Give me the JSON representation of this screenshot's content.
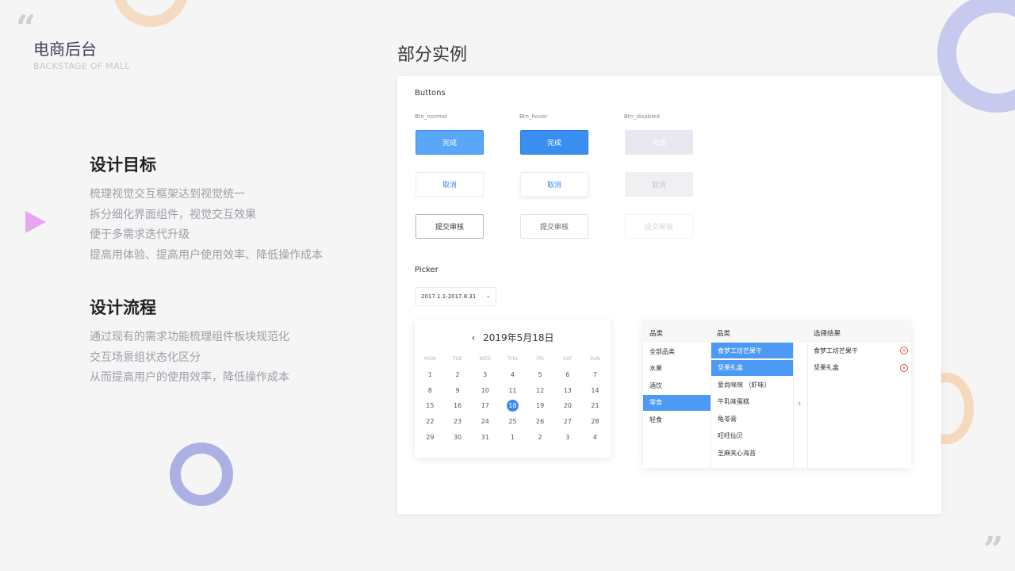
{
  "decor": {
    "open_quote": "“",
    "close_quote": "”"
  },
  "brand": {
    "title": "电商后台",
    "subtitle": "BACKSTAGE OF MALL"
  },
  "goals": {
    "title": "设计目标",
    "lines": [
      "梳理视觉交互框架达到视觉统一",
      "拆分细化界面组件，视觉交互效果",
      "便于多需求迭代升级",
      "提高用体验、提高用户使用效率、降低操作成本"
    ]
  },
  "process": {
    "title": "设计流程",
    "lines": [
      "通过现有的需求功能梳理组件板块规范化",
      "交互场景组状态化区分",
      "从而提高用户的使用效率，降低操作成本"
    ]
  },
  "main_title": "部分实例",
  "buttons": {
    "section_label": "Buttons",
    "states": [
      "Btn_normat",
      "Btn_hover",
      "Btn_disabled"
    ],
    "primary_label": "完成",
    "cancel_label": "取消",
    "submit_label": "提交审核"
  },
  "picker": {
    "section_label": "Picker",
    "value": "2017.1.1-2017.8.31",
    "calendar_title": "2019年5月18日",
    "weekdays": [
      "MON",
      "TUE",
      "WED",
      "THU",
      "FRI",
      "SAT",
      "SUN"
    ],
    "weeks": [
      [
        "1",
        "2",
        "3",
        "4",
        "5",
        "6",
        "7"
      ],
      [
        "8",
        "9",
        "10",
        "11",
        "12",
        "13",
        "14"
      ],
      [
        "15",
        "16",
        "17",
        "18",
        "19",
        "20",
        "21"
      ],
      [
        "22",
        "23",
        "24",
        "25",
        "26",
        "27",
        "28"
      ],
      [
        "29",
        "30",
        "31",
        "1",
        "2",
        "3",
        "4"
      ]
    ],
    "selected_day": "18"
  },
  "transfer": {
    "col1_title": "品类",
    "col2_title": "品类",
    "col3_title": "选择结果",
    "categories": [
      "全部品类",
      "水果",
      "酒饮",
      "零食",
      "轻食"
    ],
    "active_category": "零食",
    "products": [
      "食梦工坊芒果干",
      "坚果礼盒",
      "爱尚咪咪 （虾味）",
      "牛乳味蛋糕",
      "龟苓膏",
      "旺旺仙贝",
      "芝麻夹心海苔"
    ],
    "selected_products": [
      "食梦工坊芒果干",
      "坚果礼盒"
    ],
    "results": [
      "食梦工坊芒果干",
      "坚果礼盒"
    ]
  },
  "colors": {
    "accent": "#3b8bea",
    "danger": "#e0504f"
  }
}
